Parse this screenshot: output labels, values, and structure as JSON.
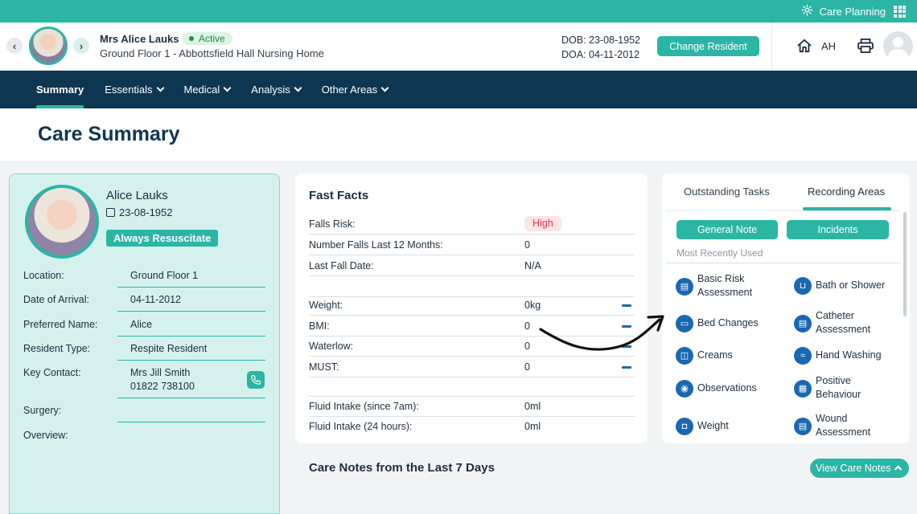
{
  "topbar": {
    "label": "Care Planning",
    "icons": [
      "gear-icon",
      "apps-grid-icon"
    ]
  },
  "header": {
    "resident_name": "Mrs Alice Lauks",
    "status": "Active",
    "location": "Ground Floor 1 - Abbottsfield Hall Nursing Home",
    "dob": "DOB: 23-08-1952",
    "doa": "DOA: 04-11-2012",
    "change_button": "Change Resident",
    "initials": "AH"
  },
  "nav": {
    "tabs": [
      {
        "label": "Summary",
        "selected": true
      },
      {
        "label": "Essentials"
      },
      {
        "label": "Medical"
      },
      {
        "label": "Analysis"
      },
      {
        "label": "Other Areas"
      }
    ]
  },
  "page": {
    "title": "Care Summary"
  },
  "profile": {
    "name": "Alice Lauks",
    "dob": "23-08-1952",
    "resus_badge": "Always Resuscitate",
    "fields": [
      {
        "label": "Location:",
        "value": "Ground Floor 1"
      },
      {
        "label": "Date of Arrival:",
        "value": "04-11-2012"
      },
      {
        "label": "Preferred Name:",
        "value": "Alice"
      },
      {
        "label": "Resident Type:",
        "value": "Respite Resident"
      },
      {
        "label": "Key Contact:",
        "value": "Mrs Jill Smith",
        "value2": "01822 738100"
      },
      {
        "label": "Surgery:",
        "value": ""
      },
      {
        "label": "Overview:",
        "value": ""
      }
    ]
  },
  "fast_facts": {
    "title": "Fast Facts",
    "rows": [
      {
        "label": "Falls Risk:",
        "value": "High"
      },
      {
        "label": "Number Falls Last 12 Months:",
        "value": "0"
      },
      {
        "label": "Last Fall Date:",
        "value": "N/A"
      },
      {
        "label": "Weight:",
        "value": "0kg"
      },
      {
        "label": "BMI:",
        "value": "0"
      },
      {
        "label": "Waterlow:",
        "value": "0"
      },
      {
        "label": "MUST:",
        "value": "0"
      },
      {
        "label": "Fluid Intake (since 7am):",
        "value": "0ml"
      },
      {
        "label": "Fluid Intake (24 hours):",
        "value": "0ml"
      }
    ]
  },
  "recording": {
    "tabs": [
      "Outstanding Tasks",
      "Recording Areas"
    ],
    "buttons": [
      "General Note",
      "Incidents"
    ],
    "section": "Most Recently Used",
    "items": [
      {
        "l1": "Basic Risk",
        "l2": "Assessment",
        "icon": "clipboard-icon"
      },
      {
        "l1": "Bath or Shower",
        "l2": "",
        "icon": "bath-icon"
      },
      {
        "l1": "Bed Changes",
        "l2": "",
        "icon": "bed-icon"
      },
      {
        "l1": "Catheter",
        "l2": "Assessment",
        "icon": "clipboard-icon"
      },
      {
        "l1": "Creams",
        "l2": "",
        "icon": "cream-jar-icon"
      },
      {
        "l1": "Hand Washing",
        "l2": "",
        "icon": "hand-wash-icon"
      },
      {
        "l1": "Observations",
        "l2": "",
        "icon": "observations-icon"
      },
      {
        "l1": "Positive",
        "l2": "Behaviour",
        "icon": "calendar-grid-icon"
      },
      {
        "l1": "Weight",
        "l2": "",
        "icon": "scale-icon"
      },
      {
        "l1": "Wound",
        "l2": "Assessment",
        "icon": "clipboard-icon"
      }
    ]
  },
  "care_notes": {
    "title": "Care Notes from the Last 7 Days",
    "button": "View Care Notes"
  },
  "colors": {
    "teal": "#2bb5a5",
    "navy": "#0f3651",
    "icon_blue": "#1a68b0",
    "high_red": "#d43a4a"
  }
}
